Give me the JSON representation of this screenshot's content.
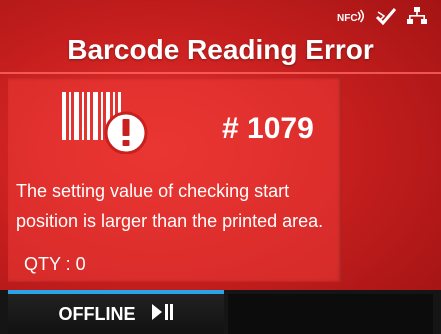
{
  "status_icons": [
    "nfc-icon",
    "bluetooth-check-icon",
    "network-icon"
  ],
  "status_nfc_label": "NFC",
  "title": "Barcode Reading Error",
  "error": {
    "icon": "barcode-error-icon",
    "code": "# 1079",
    "message": "The setting value of checking start position is larger than the printed area.",
    "qty": "QTY : 0"
  },
  "bottom_bar": {
    "offline_label": "OFFLINE",
    "play_pause_icon": "play-pause-icon"
  },
  "colors": {
    "screen_bg": "#c81f1f",
    "accent_bar": "#2aa4e6",
    "text": "#ffffff"
  }
}
